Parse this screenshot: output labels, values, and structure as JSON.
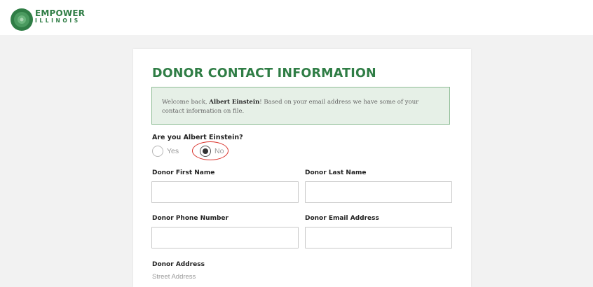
{
  "brand": {
    "name_top": "EMPOWER",
    "name_bottom": "ILLINOIS",
    "color": "#2f7d45"
  },
  "form": {
    "title": "DONOR CONTACT INFORMATION",
    "notice": {
      "prefix": "Welcome back, ",
      "name": "Albert Einstein",
      "suffix": "! Based on your email address we have some of your contact information on file."
    },
    "identity_question": "Are you Albert Einstein?",
    "identity_options": [
      {
        "label": "Yes",
        "selected": false
      },
      {
        "label": "No",
        "selected": true
      }
    ],
    "fields": {
      "first_name": {
        "label": "Donor First Name",
        "value": ""
      },
      "last_name": {
        "label": "Donor Last Name",
        "value": ""
      },
      "phone": {
        "label": "Donor Phone Number",
        "value": ""
      },
      "email": {
        "label": "Donor Email Address",
        "value": ""
      }
    },
    "address": {
      "label": "Donor Address",
      "street_label": "Street Address"
    }
  },
  "colors": {
    "notice_bg": "#e6f0e7",
    "notice_border": "#8fbd96",
    "highlight": "#d9322b"
  }
}
